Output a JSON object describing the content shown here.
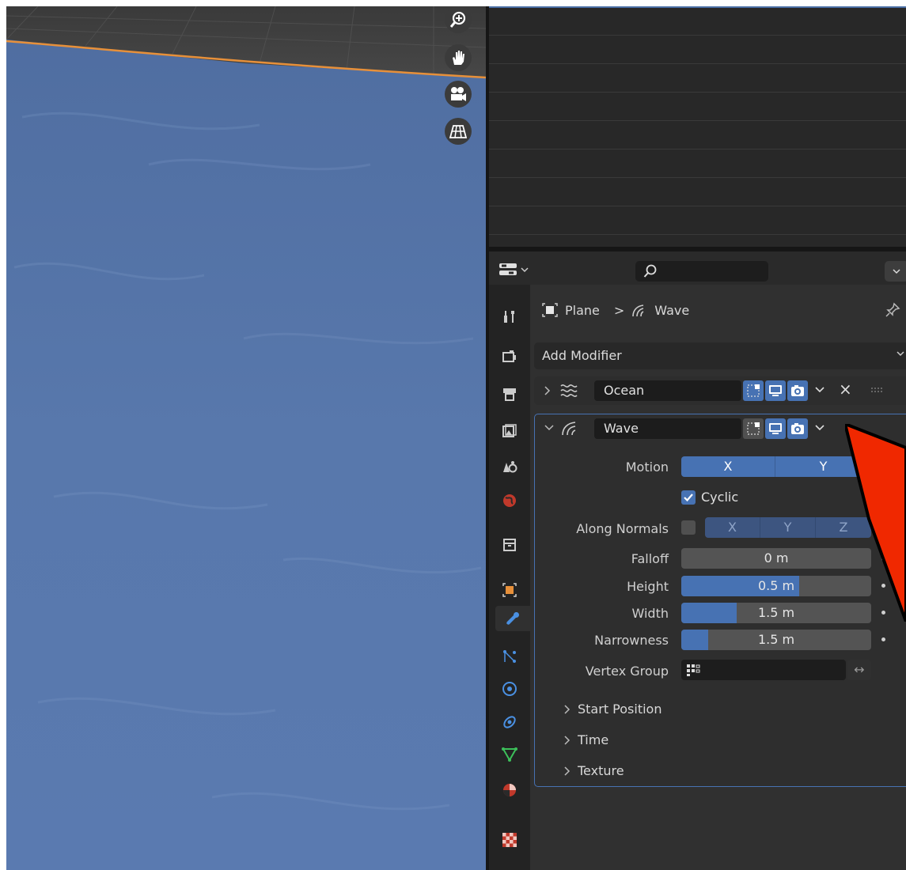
{
  "breadcrumb": {
    "object": "Plane",
    "separator": ">",
    "modifier": "Wave"
  },
  "add_modifier": {
    "label": "Add Modifier"
  },
  "modifiers": {
    "ocean": {
      "name": "Ocean",
      "collapsed": true
    },
    "wave": {
      "name": "Wave",
      "collapsed": false,
      "motion": {
        "label": "Motion",
        "x": "X",
        "y": "Y"
      },
      "cyclic": {
        "label": "Cyclic",
        "checked": true
      },
      "along_normals": {
        "label": "Along Normals",
        "x": "X",
        "y": "Y",
        "z": "Z"
      },
      "falloff": {
        "label": "Falloff",
        "value": "0 m",
        "fill": 0.0
      },
      "height": {
        "label": "Height",
        "value": "0.5 m",
        "fill": 0.62
      },
      "width": {
        "label": "Width",
        "value": "1.5 m",
        "fill": 0.29
      },
      "narrowness": {
        "label": "Narrowness",
        "value": "1.5 m",
        "fill": 0.14
      },
      "vertex_group": {
        "label": "Vertex Group",
        "value": "",
        "swap_glyph": "↔"
      },
      "subpanels": [
        "Start Position",
        "Time",
        "Texture"
      ]
    }
  },
  "icons": {
    "close": "×",
    "expanded": "›"
  },
  "colors": {
    "accent": "#4772b3",
    "water": "#5574a8",
    "edge": "#e7903a",
    "arrow": "#f02800"
  }
}
